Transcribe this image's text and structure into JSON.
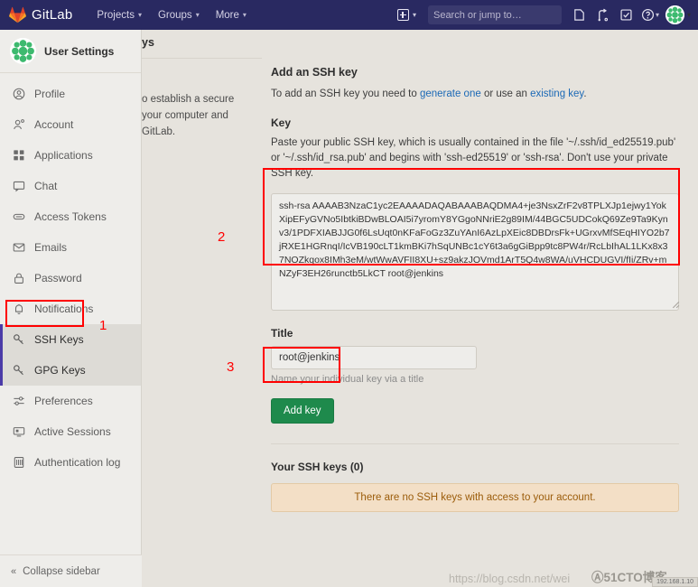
{
  "topnav": {
    "brand": "GitLab",
    "items": [
      {
        "label": "Projects",
        "caret": "⌄"
      },
      {
        "label": "Groups",
        "caret": "⌄"
      },
      {
        "label": "More",
        "caret": "⌄"
      }
    ],
    "create_new_label": "",
    "search": {
      "placeholder": "Search or jump to…",
      "value": ""
    },
    "icons": [
      "plus-square-icon",
      "search-icon",
      "issues-icon",
      "merge-requests-icon",
      "todos-icon",
      "help-icon",
      "user-avatar"
    ]
  },
  "sidebar": {
    "title": "User Settings",
    "items": [
      {
        "label": "Profile",
        "icon": "profile-icon",
        "active": false
      },
      {
        "label": "Account",
        "icon": "account-icon",
        "active": false
      },
      {
        "label": "Applications",
        "icon": "applications-icon",
        "active": false
      },
      {
        "label": "Chat",
        "icon": "chat-icon",
        "active": false
      },
      {
        "label": "Access Tokens",
        "icon": "access-tokens-icon",
        "active": false
      },
      {
        "label": "Emails",
        "icon": "emails-icon",
        "active": false
      },
      {
        "label": "Password",
        "icon": "password-lock-icon",
        "active": false
      },
      {
        "label": "Notifications",
        "icon": "notifications-bell-icon",
        "active": false
      },
      {
        "label": "SSH Keys",
        "icon": "ssh-key-icon",
        "active": true
      },
      {
        "label": "GPG Keys",
        "icon": "gpg-key-icon",
        "active": true
      },
      {
        "label": "Preferences",
        "icon": "preferences-icon",
        "active": false
      },
      {
        "label": "Active Sessions",
        "icon": "active-sessions-icon",
        "active": false
      },
      {
        "label": "Authentication log",
        "icon": "authentication-log-icon",
        "active": false
      }
    ],
    "collapse_label": "Collapse sidebar"
  },
  "subcolumn": {
    "page_heading_fragment": "ys",
    "description_line1": "o establish a secure",
    "description_line2": "your computer and GitLab."
  },
  "main": {
    "add_key_heading": "Add an SSH key",
    "add_key_desc_pre": "To add an SSH key you need to ",
    "add_key_link_generate": "generate one",
    "add_key_desc_mid": " or use an ",
    "add_key_link_existing": "existing key",
    "add_key_desc_post": ".",
    "key_label": "Key",
    "key_desc": "Paste your public SSH key, which is usually contained in the file '~/.ssh/id_ed25519.pub' or '~/.ssh/id_rsa.pub' and begins with 'ssh-ed25519' or 'ssh-rsa'. Don't use your private SSH key.",
    "key_value": "ssh-rsa AAAAB3NzaC1yc2EAAAADAQABAAABAQDMA4+je3NsxZrF2v8TPLXJp1ejwy1YokXipEFyGVNo5IbtkiBDwBLOAI5i7yromY8YGgoNNriE2g89IM/44BGC5UDCokQ69Ze9Ta9Kynv3/1PDFXIABJJG0f6LsUqt0nKFaFoGz3ZuYAnI6AzLpXEic8DBDrsFk+UGrxvMfSEqHIYO2b7jRXE1HGRnqI/IcVB190cLT1kmBKi7hSqUNBc1cY6t3a6gGiBpp9tc8PW4r/RcLbIhAL1LKx8x37NOZkqox8IMh3eM/wtWwAVFII8XU+sz9akzJOVmd1ArT5Q4w8WA/uVHCDUGVI/fIi/ZRv+mNZyF3EH26runctb5LkCT root@jenkins",
    "title_label": "Title",
    "title_value": "root@jenkins",
    "title_helper": "Name your individual key via a title",
    "add_key_button": "Add key",
    "your_keys_heading": "Your SSH keys (0)",
    "empty_message": "There are no SSH keys with access to your account."
  },
  "annotations": [
    {
      "number": "1",
      "target": "sidebar-item-ssh-keys"
    },
    {
      "number": "2",
      "target": "ssh-key-textarea"
    },
    {
      "number": "3",
      "target": "add-key-button"
    }
  ],
  "watermarks": {
    "url": "https://blog.csdn.net/wei",
    "site": "Ⓐ51CTO博客",
    "ip": "192.168.1.10"
  },
  "colors": {
    "nav_bg": "#292961",
    "page_bg": "#e6e3dd",
    "sidebar_bg": "#eeedea",
    "accent_link": "#1b69b6",
    "button_green": "#1e8a4c",
    "annotation_red": "#ff0000",
    "alert_bg": "#f3dfc6",
    "alert_text": "#9b5c0a",
    "active_marker": "#4b3ba8"
  }
}
